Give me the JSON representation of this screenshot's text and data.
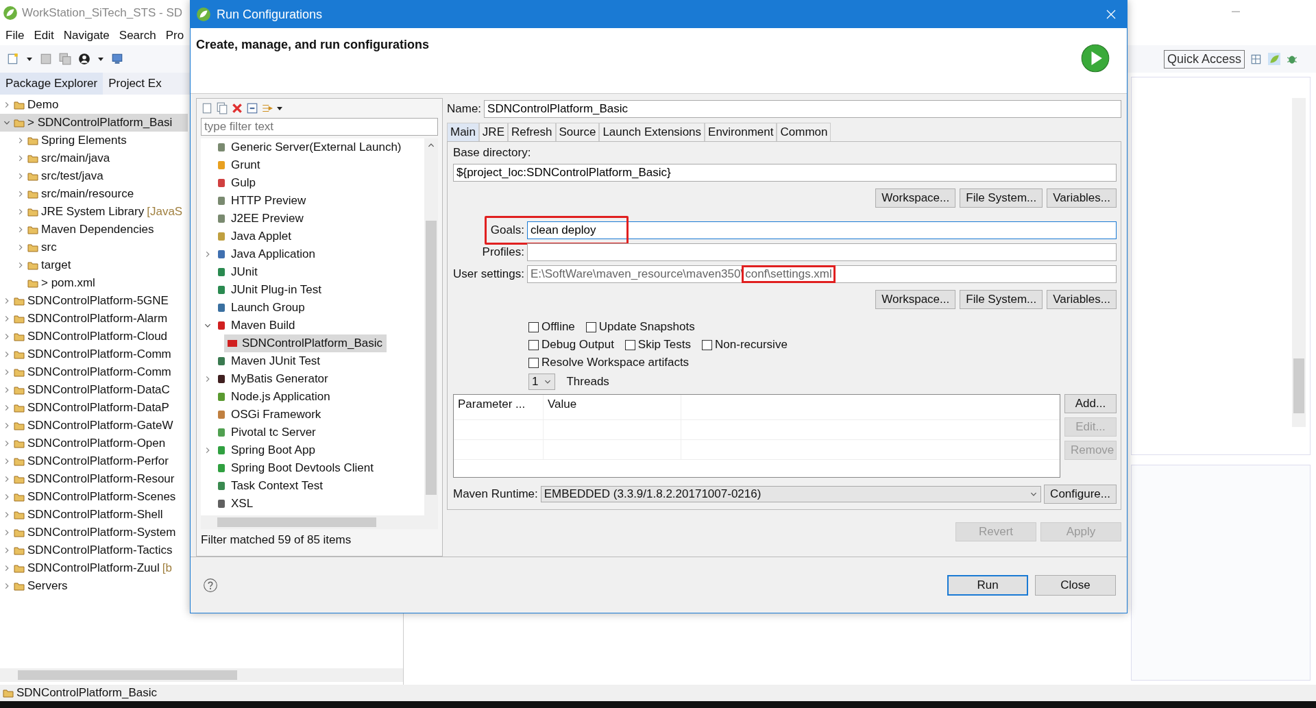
{
  "ide": {
    "title": "WorkStation_SiTech_STS - SD",
    "menu": [
      "File",
      "Edit",
      "Navigate",
      "Search",
      "Pro"
    ],
    "view_tabs": [
      {
        "label": "Package Explorer",
        "selected": true
      },
      {
        "label": "Project Ex",
        "selected": false
      }
    ],
    "tree": [
      {
        "label": "Demo",
        "expanded": false,
        "selected": false
      },
      {
        "label": "> SDNControlPlatform_Basi",
        "expanded": true,
        "selected": true,
        "children": [
          {
            "label": "Spring Elements",
            "expanded": false,
            "selected": false
          },
          {
            "label": "src/main/java",
            "expanded": false,
            "selected": false
          },
          {
            "label": "src/test/java",
            "expanded": false,
            "selected": false
          },
          {
            "label": "src/main/resource",
            "expanded": false,
            "selected": false
          },
          {
            "label": "JRE System Library",
            "decoration": "[JavaS",
            "expanded": false,
            "selected": false
          },
          {
            "label": "Maven Dependencies",
            "expanded": false,
            "selected": false
          },
          {
            "label": "src",
            "expanded": false,
            "selected": false
          },
          {
            "label": "target",
            "expanded": false,
            "selected": false
          },
          {
            "label": "> pom.xml",
            "selected": false
          }
        ]
      },
      {
        "label": "SDNControlPlatform-5GNE",
        "expanded": false,
        "selected": false
      },
      {
        "label": "SDNControlPlatform-Alarm",
        "expanded": false,
        "selected": false
      },
      {
        "label": "SDNControlPlatform-Cloud",
        "expanded": false,
        "selected": false
      },
      {
        "label": "SDNControlPlatform-Comm",
        "expanded": false,
        "selected": false
      },
      {
        "label": "SDNControlPlatform-Comm",
        "expanded": false,
        "selected": false
      },
      {
        "label": "SDNControlPlatform-DataC",
        "expanded": false,
        "selected": false
      },
      {
        "label": "SDNControlPlatform-DataP",
        "expanded": false,
        "selected": false
      },
      {
        "label": "SDNControlPlatform-GateW",
        "expanded": false,
        "selected": false
      },
      {
        "label": "SDNControlPlatform-Open",
        "expanded": false,
        "selected": false
      },
      {
        "label": "SDNControlPlatform-Perfor",
        "expanded": false,
        "selected": false
      },
      {
        "label": "SDNControlPlatform-Resour",
        "expanded": false,
        "selected": false
      },
      {
        "label": "SDNControlPlatform-Scenes",
        "expanded": false,
        "selected": false
      },
      {
        "label": "SDNControlPlatform-Shell",
        "expanded": false,
        "selected": false
      },
      {
        "label": "SDNControlPlatform-System",
        "expanded": false,
        "selected": false
      },
      {
        "label": "SDNControlPlatform-Tactics",
        "expanded": false,
        "selected": false
      },
      {
        "label": "SDNControlPlatform-Zuul",
        "decoration": "[b",
        "expanded": false,
        "selected": false
      },
      {
        "label": "Servers",
        "expanded": false,
        "selected": false
      }
    ],
    "quick_access": "Quick Access",
    "status": "SDNControlPlatform_Basic"
  },
  "dialog": {
    "title": "Run Configurations",
    "heading": "Create, manage, and run configurations",
    "filter": {
      "placeholder": "type filter text"
    },
    "launch_types": [
      {
        "label": "Generic Server(External Launch)",
        "selected": false
      },
      {
        "label": "Grunt",
        "selected": false
      },
      {
        "label": "Gulp",
        "selected": false
      },
      {
        "label": "HTTP Preview",
        "selected": false
      },
      {
        "label": "J2EE Preview",
        "selected": false
      },
      {
        "label": "Java Applet",
        "selected": false
      },
      {
        "label": "Java Application",
        "expanded": false,
        "selected": false
      },
      {
        "label": "JUnit",
        "selected": false
      },
      {
        "label": "JUnit Plug-in Test",
        "selected": false
      },
      {
        "label": "Launch Group",
        "selected": false
      },
      {
        "label": "Maven Build",
        "expanded": true,
        "selected": false,
        "children": [
          {
            "label": "SDNControlPlatform_Basic",
            "selected": true
          }
        ]
      },
      {
        "label": "Maven JUnit Test",
        "selected": false
      },
      {
        "label": "MyBatis Generator",
        "expanded": false,
        "selected": false
      },
      {
        "label": "Node.js Application",
        "selected": false
      },
      {
        "label": "OSGi Framework",
        "selected": false
      },
      {
        "label": "Pivotal tc Server",
        "selected": false
      },
      {
        "label": "Spring Boot App",
        "expanded": false,
        "selected": false
      },
      {
        "label": "Spring Boot Devtools Client",
        "selected": false
      },
      {
        "label": "Task Context Test",
        "selected": false
      },
      {
        "label": "XSL",
        "selected": false
      }
    ],
    "filter_status": "Filter matched 59 of 85 items",
    "name_label": "Name:",
    "name": "SDNControlPlatform_Basic",
    "tabs": [
      {
        "label": "Main",
        "selected": true
      },
      {
        "label": "JRE",
        "selected": false
      },
      {
        "label": "Refresh",
        "selected": false
      },
      {
        "label": "Source",
        "selected": false
      },
      {
        "label": "Launch Extensions",
        "selected": false
      },
      {
        "label": "Environment",
        "selected": false
      },
      {
        "label": "Common",
        "selected": false
      }
    ],
    "base_directory": {
      "label": "Base directory:",
      "value": "${project_loc:SDNControlPlatform_Basic}"
    },
    "dir_buttons": [
      "Workspace...",
      "File System...",
      "Variables..."
    ],
    "goals": {
      "label": "Goals:",
      "value": "clean deploy",
      "focused": true,
      "highlighted": true
    },
    "profiles": {
      "label": "Profiles:"
    },
    "user_settings": {
      "label": "User settings:",
      "value_parts": [
        {
          "text": "E:\\SoftWare\\maven_resource\\maven350\\",
          "highlighted": false
        },
        {
          "text": "conf\\settings.xml",
          "highlighted": true
        }
      ]
    },
    "settings_buttons": [
      "Workspace...",
      "File System...",
      "Variables..."
    ],
    "options": [
      [
        {
          "label": "Offline",
          "checked": false
        },
        {
          "label": "Update Snapshots",
          "checked": false
        }
      ],
      [
        {
          "label": "Debug Output",
          "checked": false
        },
        {
          "label": "Skip Tests",
          "checked": false
        },
        {
          "label": "Non-recursive",
          "checked": false
        }
      ],
      [
        {
          "label": "Resolve Workspace artifacts",
          "checked": false
        }
      ]
    ],
    "threads": {
      "value": "1",
      "label": "Threads"
    },
    "parameters": {
      "columns": [
        "Parameter ...",
        "Value"
      ]
    },
    "parameter_buttons": [
      {
        "label": "Add...",
        "disabled": false
      },
      {
        "label": "Edit...",
        "disabled": true
      },
      {
        "label": "Remove",
        "disabled": true
      }
    ],
    "runtime": {
      "label": "Maven Runtime:",
      "value": "EMBEDDED (3.3.9/1.8.2.20171007-0216)",
      "button": "Configure..."
    },
    "revert_apply": [
      {
        "label": "Revert",
        "disabled": true
      },
      {
        "label": "Apply",
        "disabled": true
      }
    ],
    "footer_buttons": [
      {
        "label": "Run",
        "default": true
      },
      {
        "label": "Close",
        "default": false
      }
    ]
  }
}
